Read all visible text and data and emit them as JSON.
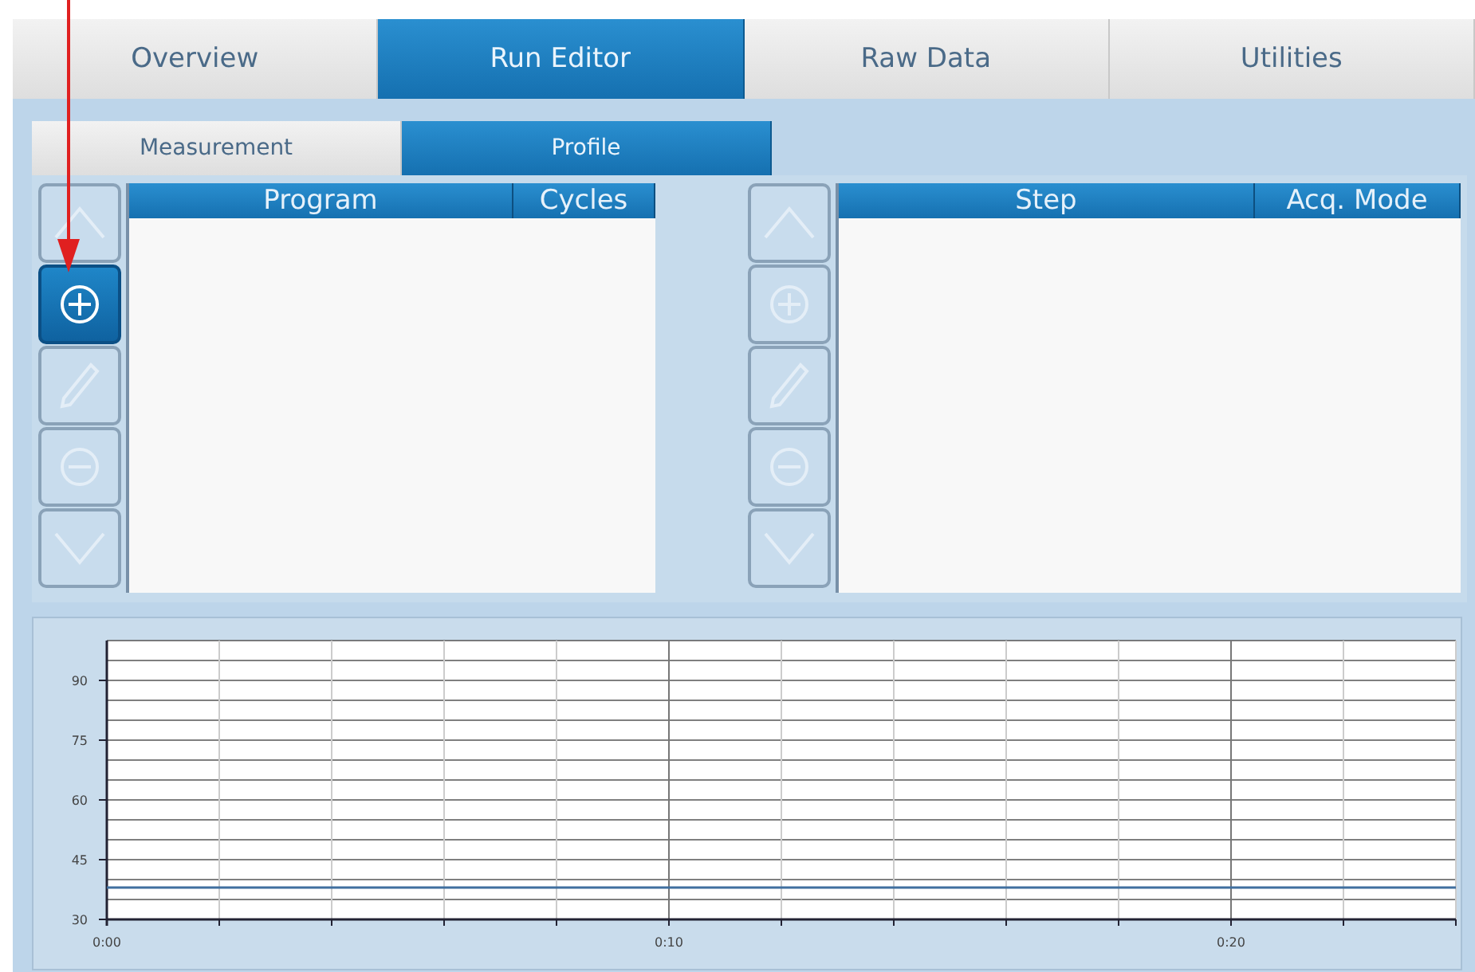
{
  "tabs": [
    {
      "label": "Overview",
      "selected": false
    },
    {
      "label": "Run Editor",
      "selected": true
    },
    {
      "label": "Raw Data",
      "selected": false
    },
    {
      "label": "Utilities",
      "selected": false
    }
  ],
  "subtabs": [
    {
      "label": "Measurement",
      "selected": false
    },
    {
      "label": "Profile",
      "selected": true
    }
  ],
  "program_list": {
    "columns": [
      "Program",
      "Cycles"
    ],
    "buttons": [
      {
        "kind": "up",
        "disabled": true
      },
      {
        "kind": "add",
        "disabled": false
      },
      {
        "kind": "edit",
        "disabled": true
      },
      {
        "kind": "remove",
        "disabled": true
      },
      {
        "kind": "down",
        "disabled": true
      }
    ]
  },
  "step_list": {
    "columns": [
      "Step",
      "Acq. Mode"
    ],
    "buttons": [
      {
        "kind": "up",
        "disabled": true
      },
      {
        "kind": "add",
        "disabled": true
      },
      {
        "kind": "edit",
        "disabled": true
      },
      {
        "kind": "remove",
        "disabled": true
      },
      {
        "kind": "down",
        "disabled": true
      }
    ]
  },
  "callout_arrow": true,
  "chart_data": {
    "type": "line",
    "x": [
      0,
      24
    ],
    "series": [
      {
        "color": "#3f6f9f",
        "values": [
          38,
          38
        ]
      }
    ],
    "grid": true,
    "xlim": [
      0,
      24
    ],
    "ylim": [
      30,
      100
    ],
    "xticks": [
      {
        "value": 0,
        "label": "0:00"
      },
      {
        "value": 10,
        "label": "0:10"
      },
      {
        "value": 20,
        "label": "0:20"
      }
    ],
    "yticks": [
      30,
      45,
      60,
      75,
      90
    ]
  }
}
